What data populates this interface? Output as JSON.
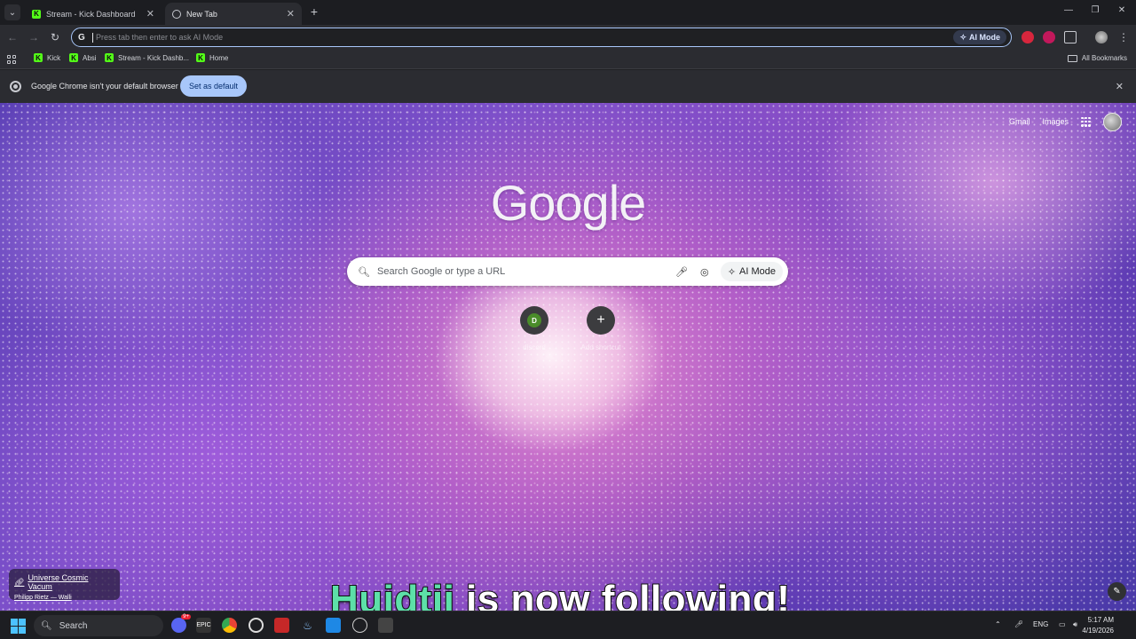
{
  "browser": {
    "tabs": [
      {
        "label": "Stream - Kick Dashboard",
        "favicon": "kick-icon",
        "active": false
      },
      {
        "label": "New Tab",
        "favicon": "globe-icon",
        "active": true
      }
    ],
    "new_tab_symbol": "+",
    "window_controls": {
      "minimize": "—",
      "restore": "❐",
      "close": "✕"
    }
  },
  "toolbar": {
    "omnibox_placeholder": "Press tab then enter to ask AI Mode",
    "ai_mode_label": "AI Mode"
  },
  "bookmarks": {
    "items": [
      "Kick",
      "Absi",
      "Stream - Kick Dashb...",
      "Home"
    ],
    "all_bookmarks_label": "All Bookmarks"
  },
  "infobar": {
    "message": "Google Chrome isn't your default browser",
    "button_label": "Set as default"
  },
  "newtab": {
    "top_links": {
      "gmail": "Gmail",
      "images": "Images"
    },
    "logo_text": "Google",
    "search_placeholder": "Search Google or type a URL",
    "ai_mode_label": "AI Mode",
    "shortcuts": [
      {
        "label": "discord",
        "initial": "D"
      },
      {
        "label": "Add shortcut",
        "symbol": "+"
      }
    ],
    "attribution": {
      "title": "Universe Cosmic Vacum",
      "author": "Philipp Rietz — Walli"
    }
  },
  "overlay": {
    "username": "Hujdtij",
    "message": " is now following!"
  },
  "taskbar": {
    "search_label": "Search",
    "language": "ENG",
    "time": "5:17 AM",
    "date": "4/19/2026",
    "discord_badge": "9+"
  },
  "colors": {
    "accent": "#a8c7fa",
    "kick_green": "#53fc18",
    "overlay_name": "#5de0a8"
  }
}
